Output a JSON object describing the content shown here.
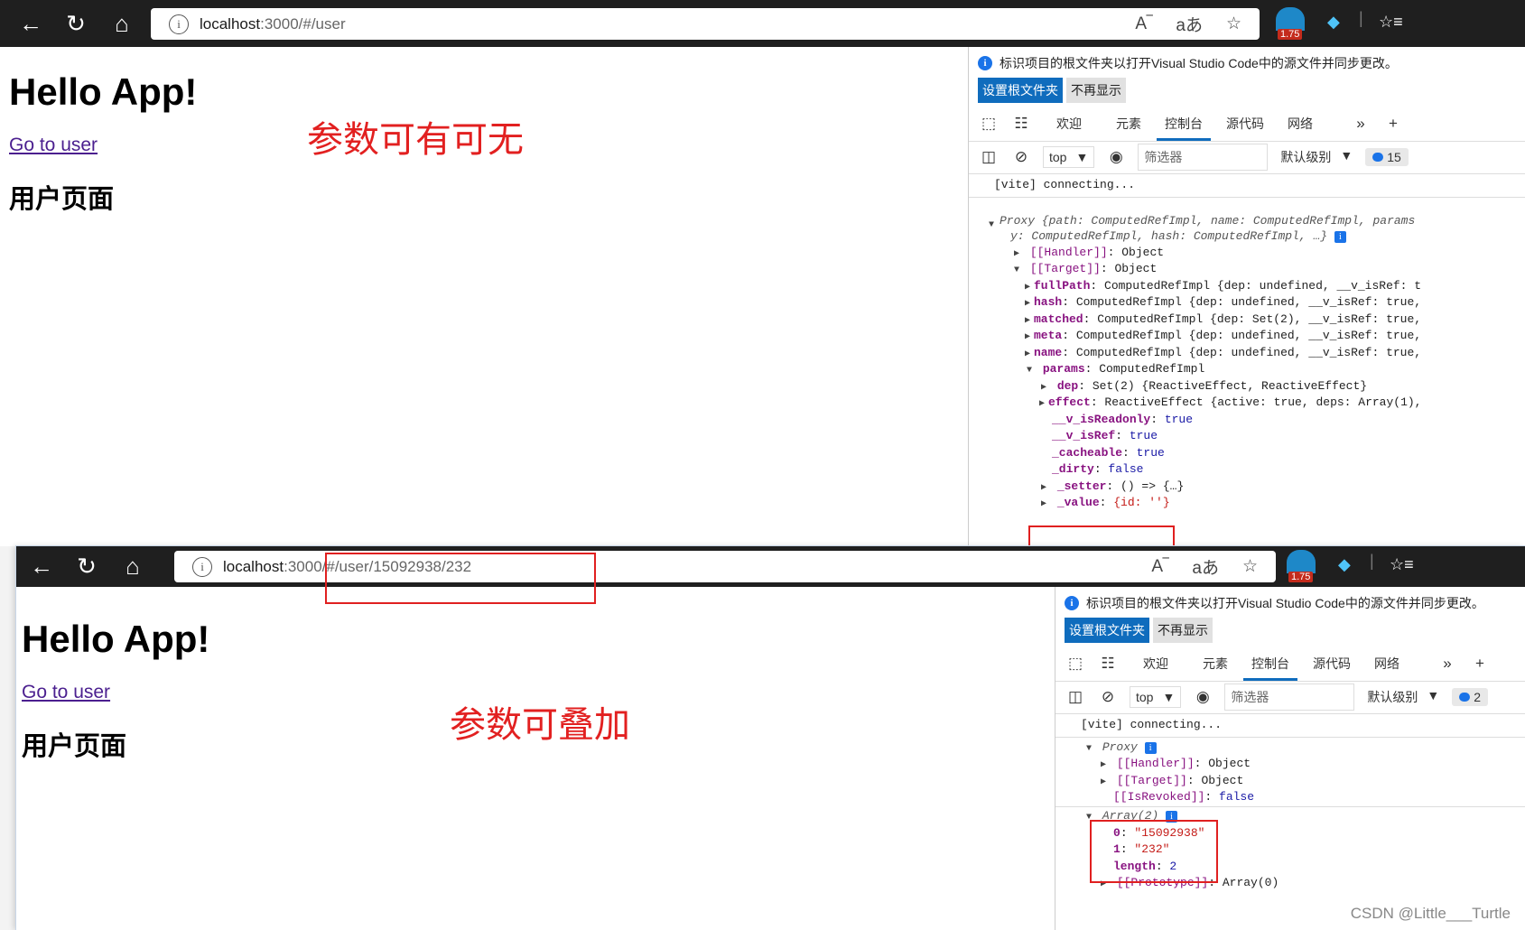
{
  "top": {
    "address": {
      "host": "localhost",
      "path": ":3000/#/user"
    },
    "ext_badge": "1.75",
    "page": {
      "title": "Hello App!",
      "link": "Go to user",
      "subtitle": "用户页面"
    },
    "annotation": "参数可有可无",
    "devtools": {
      "notice": "标识项目的根文件夹以打开Visual Studio Code中的源文件并同步更改。",
      "set_root": "设置根文件夹",
      "dont_show": "不再显示",
      "tabs": [
        "欢迎",
        "元素",
        "控制台",
        "源代码",
        "网络"
      ],
      "active_tab": 2,
      "context": "top",
      "filter_placeholder": "筛选器",
      "level": "默认级别",
      "count": "15"
    },
    "console": [
      {
        "text": "[vite] connecting..."
      },
      {
        "text": "Proxy {path: ComputedRefImpl, name: ComputedRefImpl, params"
      },
      {
        "text": "y: ComputedRefImpl, hash: ComputedRefImpl, …}"
      },
      {
        "key": "[[Handler]]",
        "val": "Object"
      },
      {
        "key": "[[Target]]",
        "val": "Object"
      },
      {
        "key": "fullPath",
        "val": "ComputedRefImpl {dep: undefined, __v_isRef: t"
      },
      {
        "key": "hash",
        "val": "ComputedRefImpl {dep: undefined, __v_isRef: true,"
      },
      {
        "key": "matched",
        "val": "ComputedRefImpl {dep: Set(2), __v_isRef: true,"
      },
      {
        "key": "meta",
        "val": "ComputedRefImpl {dep: undefined, __v_isRef: true,"
      },
      {
        "key": "name",
        "val": "ComputedRefImpl {dep: undefined, __v_isRef: true,"
      },
      {
        "key": "params",
        "val": "ComputedRefImpl"
      },
      {
        "key": "dep",
        "val": "Set(2) {ReactiveEffect, ReactiveEffect}"
      },
      {
        "key": "effect",
        "val": "ReactiveEffect {active: true, deps: Array(1),"
      },
      {
        "key": "__v_isReadonly",
        "val": "true"
      },
      {
        "key": "__v_isRef",
        "val": "true"
      },
      {
        "key": "_cacheable",
        "val": "true"
      },
      {
        "key": "_dirty",
        "val": "false"
      },
      {
        "key": "_setter",
        "val": "() => {…}"
      },
      {
        "key": "_value",
        "val": "{id: ''}"
      }
    ]
  },
  "bottom": {
    "address": {
      "host": "localhost",
      "path": ":3000/#/user/15092938/232"
    },
    "ext_badge": "1.75",
    "page": {
      "title": "Hello App!",
      "link": "Go to user",
      "subtitle": "用户页面"
    },
    "annotation": "参数可叠加",
    "devtools": {
      "notice": "标识项目的根文件夹以打开Visual Studio Code中的源文件并同步更改。",
      "set_root": "设置根文件夹",
      "dont_show": "不再显示",
      "tabs": [
        "欢迎",
        "元素",
        "控制台",
        "源代码",
        "网络"
      ],
      "active_tab": 2,
      "context": "top",
      "filter_placeholder": "筛选器",
      "level": "默认级别",
      "count": "2"
    },
    "console": [
      {
        "text": "[vite] connecting..."
      },
      {
        "text": "Proxy"
      },
      {
        "key": "[[Handler]]",
        "val": "Object"
      },
      {
        "key": "[[Target]]",
        "val": "Object"
      },
      {
        "key": "[[IsRevoked]]",
        "val": "false"
      },
      {
        "text": "Array(2)"
      },
      {
        "key": "0",
        "val": "\"15092938\""
      },
      {
        "key": "1",
        "val": "\"232\""
      },
      {
        "key": "length",
        "val": "2"
      },
      {
        "key": "[[Prototype]]",
        "val": "Array(0)"
      }
    ]
  },
  "watermark": "CSDN @Little___Turtle"
}
